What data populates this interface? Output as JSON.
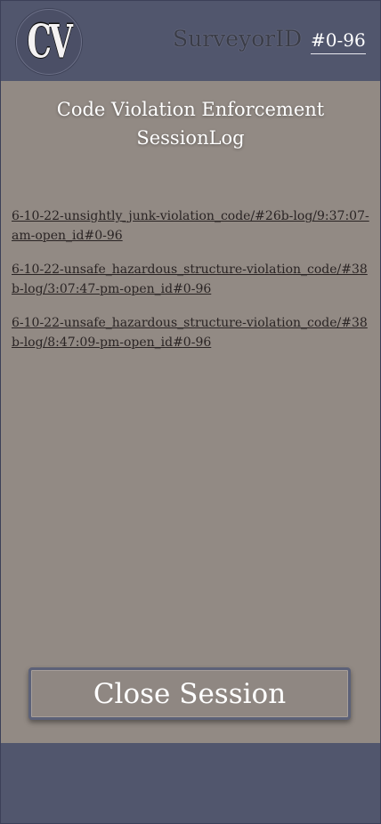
{
  "header": {
    "logo_text": "CV",
    "surveyor_label": "SurveyorID",
    "surveyor_id": "#0-96"
  },
  "title": {
    "line1": "Code Violation Enforcement",
    "line2": "SessionLog"
  },
  "log_entries": [
    "6-10-22-unsightly_junk-violation_code/#26b-log/9:37:07-am-open_id#0-96",
    "6-10-22-unsafe_hazardous_structure-violation_code/#38b-log/3:07:47-pm-open_id#0-96",
    "6-10-22-unsafe_hazardous_structure-violation_code/#38b-log/8:47:09-pm-open_id#0-96"
  ],
  "close_button_label": "Close Session"
}
